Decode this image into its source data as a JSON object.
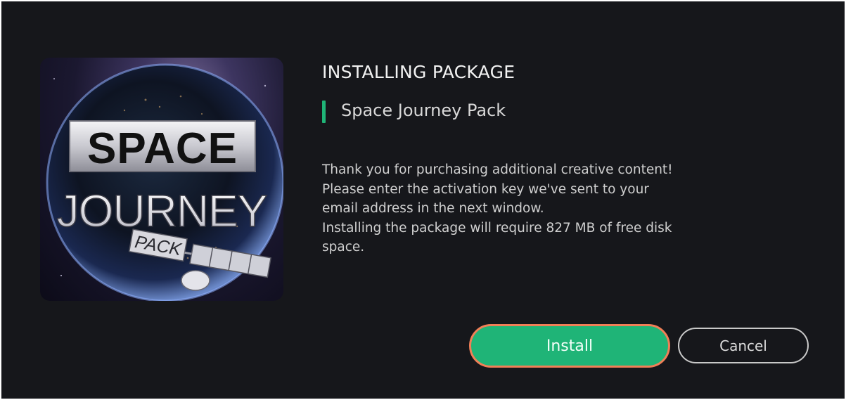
{
  "dialog": {
    "title": "INSTALLING PACKAGE",
    "package_name": "Space Journey Pack",
    "description_lines": [
      "Thank you for purchasing additional creative content!",
      "Please enter the activation key we've sent to your",
      "email address in the next window.",
      "Installing the package will require 827 MB of free disk",
      "space."
    ],
    "cover": {
      "word1": "SPACE",
      "word2": "JOURNEY",
      "word3": "PACK"
    },
    "buttons": {
      "install_label": "Install",
      "cancel_label": "Cancel"
    }
  },
  "colors": {
    "background": "#16171b",
    "accent": "#1fb477",
    "install_border": "#f07f57"
  }
}
